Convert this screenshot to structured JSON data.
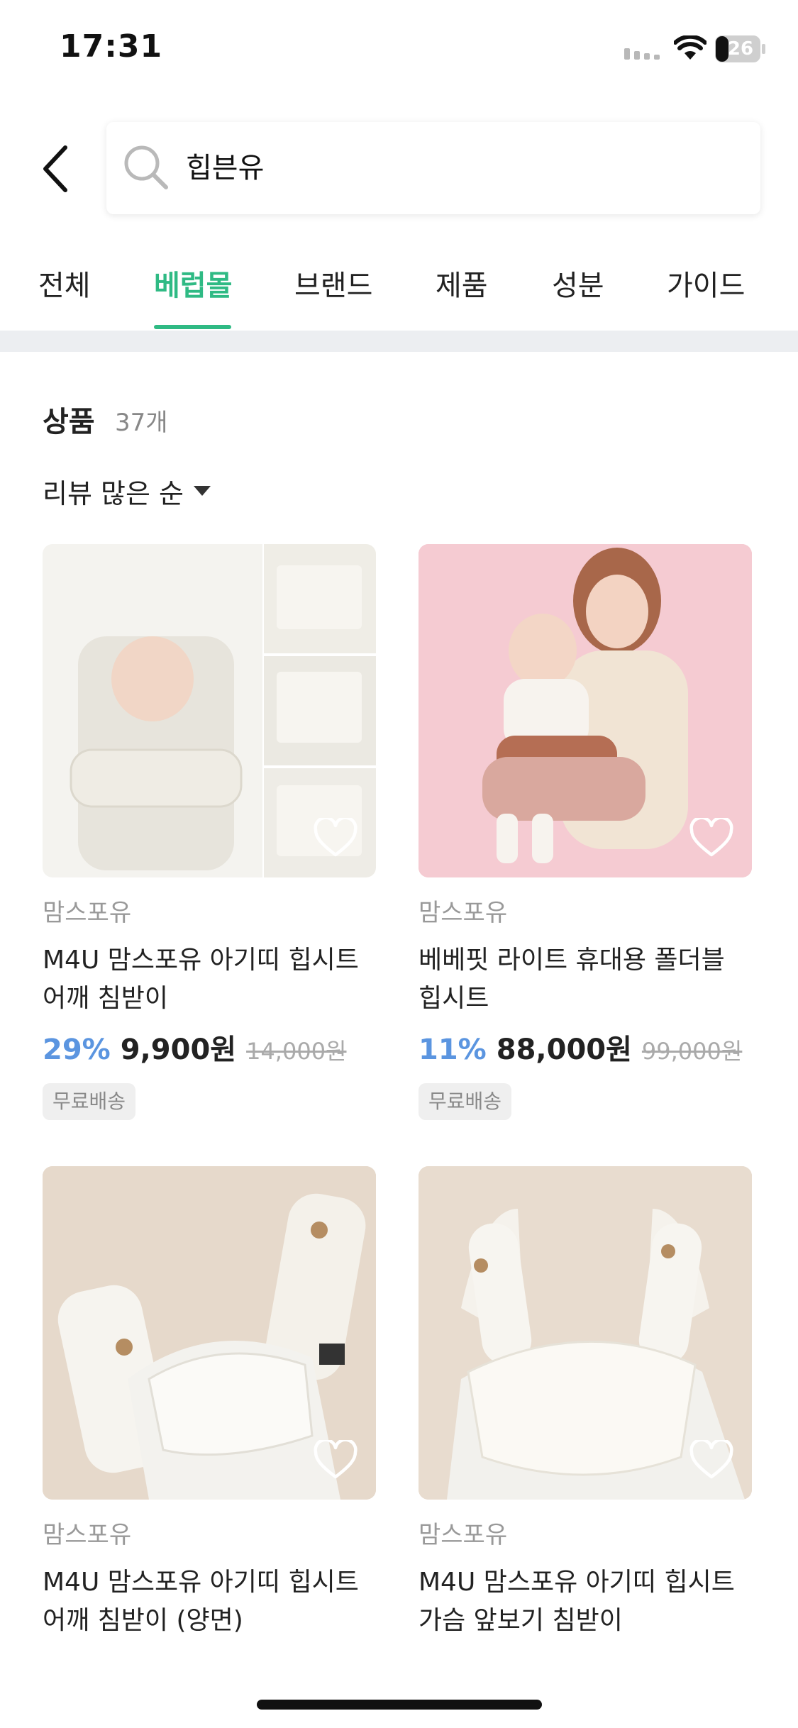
{
  "status_bar": {
    "time": "17:31",
    "battery": "26"
  },
  "search": {
    "query": "힙븐유"
  },
  "tabs": [
    {
      "label": "전체"
    },
    {
      "label": "베럽몰"
    },
    {
      "label": "브랜드"
    },
    {
      "label": "제품"
    },
    {
      "label": "성분"
    },
    {
      "label": "가이드"
    }
  ],
  "active_tab": "베럽몰",
  "products_header": {
    "title": "상품",
    "count": "37개"
  },
  "sort": {
    "label": "리뷰 많은 순"
  },
  "products": [
    {
      "brand": "맘스포유",
      "name": "M4U 맘스포유 아기띠 힙시트 어깨 침받이",
      "discount": "29%",
      "price": "9,900원",
      "original_price": "14,000원",
      "badge": "무료배송"
    },
    {
      "brand": "맘스포유",
      "name": "베베핏 라이트 휴대용 폴더블 힙시트",
      "discount": "11%",
      "price": "88,000원",
      "original_price": "99,000원",
      "badge": "무료배송"
    },
    {
      "brand": "맘스포유",
      "name": "M4U 맘스포유 아기띠 힙시트 어깨 침받이 (양면)"
    },
    {
      "brand": "맘스포유",
      "name": "M4U 맘스포유 아기띠 힙시트 가슴 앞보기 침받이"
    }
  ],
  "colors": {
    "accent": "#2fba84",
    "discount": "#5b95e0"
  }
}
